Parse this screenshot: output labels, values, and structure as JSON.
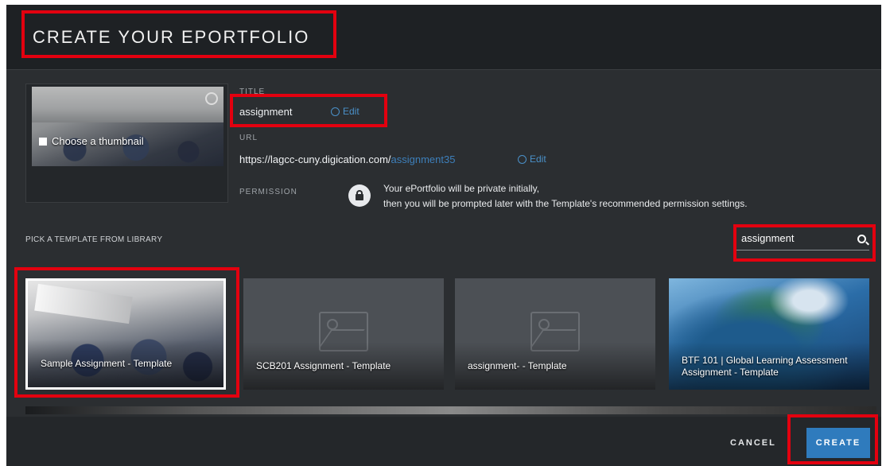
{
  "modal": {
    "title": "CREATE YOUR EPORTFOLIO"
  },
  "thumbnail": {
    "label": "Choose a thumbnail",
    "icon": "image-icon",
    "settings_icon": "gear-icon"
  },
  "form": {
    "title_label": "TITLE",
    "title_value": "assignment",
    "edit_label": "Edit",
    "url_label": "URL",
    "url_base": "https://lagcc-cuny.digication.com/",
    "url_slug": "assignment35",
    "permission_label": "PERMISSION",
    "permission_line1": "Your ePortfolio will be private initially,",
    "permission_line2": "then you will be prompted later with the Template's recommended permission settings.",
    "lock_icon": "lock-icon"
  },
  "templates": {
    "section_label": "PICK A TEMPLATE FROM LIBRARY",
    "search_value": "assignment",
    "search_icon": "search-icon",
    "items": [
      {
        "title": "Sample Assignment - Template",
        "selected": true
      },
      {
        "title": "SCB201 Assignment - Template",
        "selected": false
      },
      {
        "title": "assignment- - Template",
        "selected": false
      },
      {
        "title": "BTF 101 | Global Learning Assessment Assignment - Template",
        "selected": false
      }
    ]
  },
  "footer": {
    "cancel_label": "CANCEL",
    "create_label": "CREATE"
  },
  "colors": {
    "accent": "#2f7bbd",
    "highlight": "#e3000f",
    "link": "#4a90c8"
  }
}
